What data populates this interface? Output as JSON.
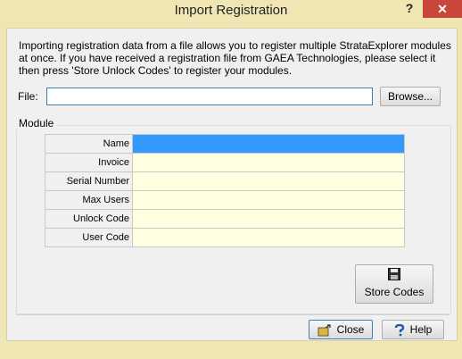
{
  "window": {
    "title": "Import Registration",
    "help_glyph": "?",
    "close_glyph": "✕"
  },
  "intro": "Importing registration data from a file allows you to register multiple StrataExplorer modules at once. If you have received a registration file from GAEA Technologies, please select it then press 'Store Unlock Codes' to register your modules.",
  "file": {
    "label": "File:",
    "value": "",
    "browse_label": "Browse..."
  },
  "module": {
    "group_label": "Module",
    "fields": [
      {
        "label": "Name",
        "value": ""
      },
      {
        "label": "Invoice",
        "value": ""
      },
      {
        "label": "Serial Number",
        "value": ""
      },
      {
        "label": "Max Users",
        "value": ""
      },
      {
        "label": "Unlock Code",
        "value": ""
      },
      {
        "label": "User Code",
        "value": ""
      }
    ],
    "selected_row": 0
  },
  "buttons": {
    "store": "Store Codes",
    "close": "Close",
    "help": "Help"
  },
  "icons": {
    "store": "floppy-disk-icon",
    "close": "door-exit-icon",
    "help": "question-mark-icon"
  },
  "colors": {
    "title_bg": "#f0e6b4",
    "close_bg": "#c9463d",
    "selection": "#3399ff",
    "cell_bg": "#ffffe1"
  }
}
